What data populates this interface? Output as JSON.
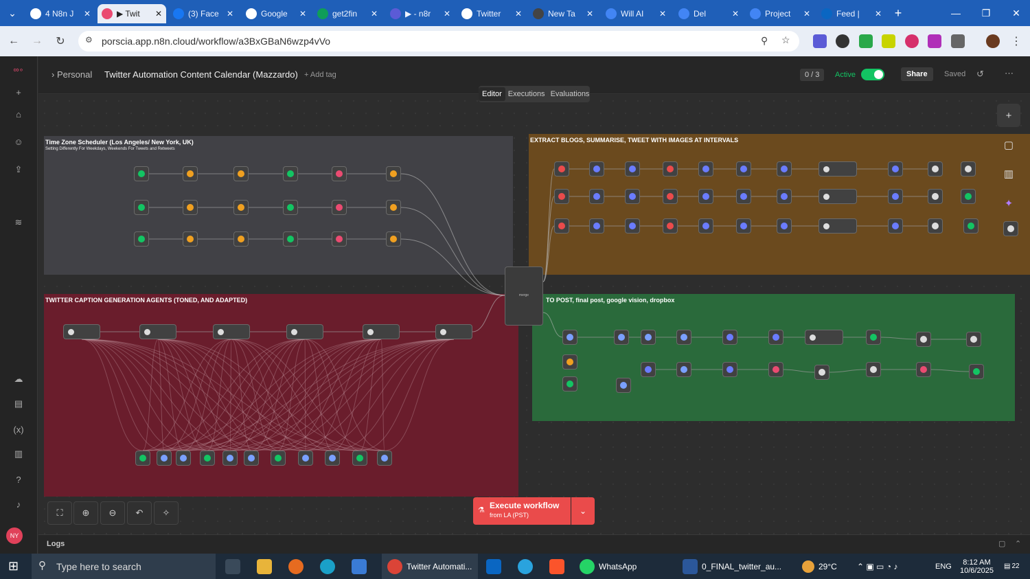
{
  "browser": {
    "tabs": [
      {
        "label": "4 N8n J",
        "icon": "youtube-icon",
        "color": "#ffffff"
      },
      {
        "label": "▶ Twit",
        "icon": "n8n-icon",
        "color": "#ea4b71",
        "active": true
      },
      {
        "label": "(3) Face",
        "icon": "facebook-icon",
        "color": "#1877f2"
      },
      {
        "label": "Google",
        "icon": "google-icon",
        "color": "#ffffff"
      },
      {
        "label": "get2fin",
        "icon": "sheets-icon",
        "color": "#0f9d58"
      },
      {
        "label": "▶ - n8r",
        "icon": "circle-icon",
        "color": "#5b5bd6"
      },
      {
        "label": "Twitter",
        "icon": "globe-icon",
        "color": "#ffffff"
      },
      {
        "label": "New Ta",
        "icon": "github-icon",
        "color": "#444444"
      },
      {
        "label": "Will AI",
        "icon": "docs-icon",
        "color": "#4285f4"
      },
      {
        "label": "Del",
        "icon": "docs-icon",
        "color": "#4285f4"
      },
      {
        "label": "Project",
        "icon": "docs-icon",
        "color": "#4285f4"
      },
      {
        "label": "Feed |",
        "icon": "linkedin-icon",
        "color": "#0a66c2"
      }
    ],
    "url": "porscia.app.n8n.cloud/workflow/a3BxGBaN6wzp4vVo"
  },
  "header": {
    "project": "Personal",
    "workflow_name": "Twitter Automation Content Calendar (Mazzardo)",
    "add_tag": "+ Add tag",
    "counter": "0 / 3",
    "active_label": "Active",
    "share": "Share",
    "saved": "Saved",
    "mode_tabs": [
      "Editor",
      "Executions",
      "Evaluations"
    ]
  },
  "stickies": [
    {
      "title": "Time Zone Scheduler (Los Angeles/ New York, UK)",
      "subtitle": "Setting Differently For Weekdays, Weekends For Tweets and Retweets",
      "color": "#414146"
    },
    {
      "title": "EXTRACT BLOGS, SUMMARISE, TWEET WITH IMAGES AT INTERVALS",
      "subtitle": "",
      "color": "#6b4a1e"
    },
    {
      "title": "TWITTER CAPTION GENERATION AGENTS (TONED, AND ADAPTED)",
      "subtitle": "",
      "color": "#6a1d2c"
    },
    {
      "title": "TO POST, final post, google vision, dropbox",
      "subtitle": "",
      "color": "#2a6a3b"
    }
  ],
  "execute": {
    "label": "Execute workflow",
    "sub": "from LA (PST)"
  },
  "logs_label": "Logs",
  "taskbar": {
    "search_placeholder": "Type here to search",
    "items": [
      "Twitter Automati...",
      "WhatsApp",
      "0_FINAL_twitter_au..."
    ],
    "weather": "29°C",
    "lang": "ENG",
    "time": "8:12 AM",
    "date": "10/6/2025",
    "notif": "22"
  },
  "colors": {
    "n8n_accent": "#ea4b71",
    "execute_bg": "#ea4b4b",
    "active_toggle": "#13c463"
  }
}
